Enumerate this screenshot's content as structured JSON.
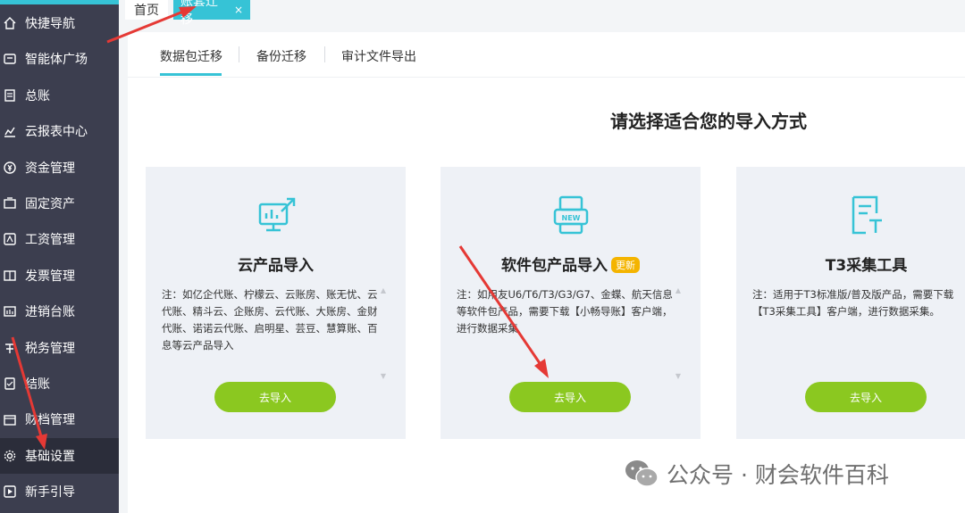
{
  "sidebar": {
    "items": [
      {
        "label": "快捷导航",
        "icon": "home-icon"
      },
      {
        "label": "智能体广场",
        "icon": "agent-icon"
      },
      {
        "label": "总账",
        "icon": "ledger-icon"
      },
      {
        "label": "云报表中心",
        "icon": "chart-icon"
      },
      {
        "label": "资金管理",
        "icon": "money-icon"
      },
      {
        "label": "固定资产",
        "icon": "asset-icon"
      },
      {
        "label": "工资管理",
        "icon": "salary-icon"
      },
      {
        "label": "发票管理",
        "icon": "invoice-icon"
      },
      {
        "label": "进销台账",
        "icon": "inventory-icon"
      },
      {
        "label": "税务管理",
        "icon": "tax-icon"
      },
      {
        "label": "结账",
        "icon": "closing-icon"
      },
      {
        "label": "财档管理",
        "icon": "archive-icon"
      },
      {
        "label": "基础设置",
        "icon": "gear-icon"
      },
      {
        "label": "新手引导",
        "icon": "play-icon"
      }
    ],
    "active_index": 12
  },
  "tabs": {
    "home": "首页",
    "active": "账套迁移",
    "close": "×"
  },
  "subtabs": [
    "数据包迁移",
    "备份迁移",
    "审计文件导出"
  ],
  "heading": "请选择适合您的导入方式",
  "cards": [
    {
      "title": "云产品导入",
      "note": "注：如亿企代账、柠檬云、云账房、账无忧、云代账、精斗云、企账房、云代账、大账房、金财代账、诺诺云代账、启明星、芸豆、慧算账、百息等云产品导入",
      "button": "去导入"
    },
    {
      "title": "软件包产品导入",
      "badge": "更新",
      "note": "注：如用友U6/T6/T3/G3/G7、金蝶、航天信息等软件包产品，需要下载【小畅导账】客户端，进行数据采集",
      "button": "去导入"
    },
    {
      "title": "T3采集工具",
      "note": "注：适用于T3标准版/普及版产品，需要下载【T3采集工具】客户端，进行数据采集。",
      "button": "去导入"
    }
  ],
  "watermark": "公众号 · 财会软件百科",
  "colors": {
    "sidebar_bg": "#3c3e4f",
    "accent": "#36c3d6",
    "button_green": "#8bc820",
    "badge_orange": "#f4b400",
    "arrow_red": "#e53935"
  }
}
